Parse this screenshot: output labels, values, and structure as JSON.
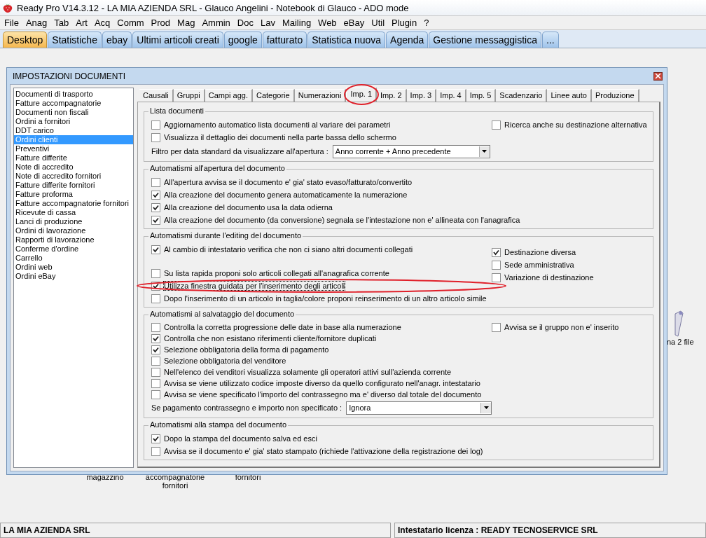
{
  "window": {
    "title": "Ready Pro V14.3.12 - LA MIA AZIENDA SRL - Glauco Angelini - Notebook di Glauco - ADO mode"
  },
  "menu": [
    "File",
    "Anag",
    "Tab",
    "Art",
    "Acq",
    "Comm",
    "Prod",
    "Mag",
    "Ammin",
    "Doc",
    "Lav",
    "Mailing",
    "Web",
    "eBay",
    "Util",
    "Plugin",
    "?"
  ],
  "tabs": [
    {
      "label": "Desktop",
      "selected": true
    },
    {
      "label": "Statistiche",
      "selected": false
    },
    {
      "label": "ebay",
      "selected": false
    },
    {
      "label": "Ultimi articoli creati",
      "selected": false
    },
    {
      "label": "google",
      "selected": false
    },
    {
      "label": "fatturato",
      "selected": false
    },
    {
      "label": "Statistica nuova",
      "selected": false
    },
    {
      "label": "Agenda",
      "selected": false
    },
    {
      "label": "Gestione messaggistica",
      "selected": false
    },
    {
      "label": "...",
      "selected": false
    }
  ],
  "desktop_icons": [
    {
      "label": "magazzino"
    },
    {
      "label": "accompagnatorie fornitori"
    },
    {
      "label": "fornitori"
    },
    {
      "label": "na 2 file"
    }
  ],
  "dialog": {
    "title": "IMPOSTAZIONI DOCUMENTI",
    "document_types": [
      {
        "label": "Documenti di trasporto",
        "selected": false
      },
      {
        "label": "Fatture accompagnatorie",
        "selected": false
      },
      {
        "label": "Documenti non fiscali",
        "selected": false
      },
      {
        "label": "Ordini a fornitori",
        "selected": false
      },
      {
        "label": "DDT carico",
        "selected": false
      },
      {
        "label": "Ordini clienti",
        "selected": true
      },
      {
        "label": "Preventivi",
        "selected": false
      },
      {
        "label": "Fatture differite",
        "selected": false
      },
      {
        "label": "Note di accredito",
        "selected": false
      },
      {
        "label": "Note di accredito fornitori",
        "selected": false
      },
      {
        "label": "Fatture differite fornitori",
        "selected": false
      },
      {
        "label": "Fatture proforma",
        "selected": false
      },
      {
        "label": "Fatture accompagnatorie fornitori",
        "selected": false
      },
      {
        "label": "Ricevute di cassa",
        "selected": false
      },
      {
        "label": "Lanci di produzione",
        "selected": false
      },
      {
        "label": "Ordini di lavorazione",
        "selected": false
      },
      {
        "label": "Rapporti di lavorazione",
        "selected": false
      },
      {
        "label": "Conferme d'ordine",
        "selected": false
      },
      {
        "label": "Carrello",
        "selected": false
      },
      {
        "label": "Ordini web",
        "selected": false
      },
      {
        "label": "Ordini eBay",
        "selected": false
      }
    ],
    "tabs": [
      {
        "label": "Causali",
        "selected": false
      },
      {
        "label": "Gruppi",
        "selected": false
      },
      {
        "label": "Campi agg.",
        "selected": false
      },
      {
        "label": "Categorie",
        "selected": false
      },
      {
        "label": "Numerazioni",
        "selected": false
      },
      {
        "label": "Imp. 1",
        "selected": true
      },
      {
        "label": "Imp. 2",
        "selected": false
      },
      {
        "label": "Imp. 3",
        "selected": false
      },
      {
        "label": "Imp. 4",
        "selected": false
      },
      {
        "label": "Imp. 5",
        "selected": false
      },
      {
        "label": "Scadenzario",
        "selected": false
      },
      {
        "label": "Linee auto",
        "selected": false
      },
      {
        "label": "Produzione",
        "selected": false
      }
    ],
    "groups": [
      {
        "title": "Lista documenti",
        "rows": [
          {
            "kind": "checkbox",
            "label": "Aggiornamento automatico lista documenti al variare dei parametri",
            "checked": false
          },
          {
            "kind": "checkbox",
            "label": "Visualizza il dettaglio dei documenti nella parte bassa dello schermo",
            "checked": false
          },
          {
            "kind": "combo",
            "label": "Filtro per data standard da visualizzare all'apertura :",
            "value": "Anno corrente + Anno precedente"
          }
        ],
        "side": [
          {
            "label": "Ricerca anche su destinazione alternativa",
            "checked": false
          }
        ]
      },
      {
        "title": "Automatismi all'apertura del documento",
        "rows": [
          {
            "kind": "checkbox",
            "label": "All'apertura avvisa se il documento e' gia' stato evaso/fatturato/convertito",
            "checked": false
          },
          {
            "kind": "checkbox",
            "label": "Alla creazione del documento genera automaticamente la numerazione",
            "checked": true
          },
          {
            "kind": "checkbox",
            "label": "Alla creazione del documento usa la data odierna",
            "checked": true
          },
          {
            "kind": "checkbox",
            "label": "Alla creazione del documento (da conversione) segnala se l'intestazione non e' allineata con l'anagrafica",
            "checked": true
          }
        ]
      },
      {
        "title": "Automatismi durante l'editing del documento",
        "rows": [
          {
            "kind": "checkbox",
            "label": "Al cambio di intestatario verifica che non ci siano altri documenti collegati",
            "checked": true
          },
          {
            "kind": "checkbox",
            "label": "Su lista rapida proponi solo articoli collegati all'anagrafica corrente",
            "checked": false,
            "gap_before": true
          },
          {
            "kind": "checkbox",
            "label": "Utilizza finestra guidata per l'inserimento degli articoli",
            "checked": true,
            "focused": true
          },
          {
            "kind": "checkbox",
            "label": "Dopo l'inserimento di un articolo in taglia/colore proponi reinserimento di un altro articolo simile",
            "checked": false
          }
        ],
        "side": [
          {
            "label": "Destinazione diversa",
            "checked": true
          },
          {
            "label": "Sede amministrativa",
            "checked": false
          },
          {
            "label": "Variazione di destinazione",
            "checked": false
          }
        ]
      },
      {
        "title": "Automatismi al salvataggio del documento",
        "rows": [
          {
            "kind": "checkbox",
            "label": "Controlla la corretta progressione delle date in base alla numerazione",
            "checked": false
          },
          {
            "kind": "checkbox",
            "label": "Controlla che non esistano riferimenti cliente/fornitore duplicati",
            "checked": true
          },
          {
            "kind": "checkbox",
            "label": "Selezione obbligatoria della forma di pagamento",
            "checked": true
          },
          {
            "kind": "checkbox",
            "label": "Selezione obbligatoria del venditore",
            "checked": false
          },
          {
            "kind": "checkbox",
            "label": "Nell'elenco dei venditori visualizza solamente gli operatori attivi sull'azienda corrente",
            "checked": false
          },
          {
            "kind": "checkbox",
            "label": "Avvisa se viene utilizzato codice imposte diverso da quello configurato nell'anagr. intestatario",
            "checked": false
          },
          {
            "kind": "checkbox",
            "label": "Avvisa se viene specificato l'importo del contrassegno ma e' diverso dal totale del documento",
            "checked": false
          },
          {
            "kind": "combo",
            "label": "Se pagamento contrassegno e importo non specificato :",
            "value": "Ignora"
          }
        ],
        "side": [
          {
            "label": "Avvisa se il gruppo non e' inserito",
            "checked": false
          }
        ]
      },
      {
        "title": "Automatismi alla stampa del documento",
        "rows": [
          {
            "kind": "checkbox",
            "label": "Dopo la stampa del documento salva ed esci",
            "checked": true
          },
          {
            "kind": "checkbox",
            "label": "Avvisa se il documento e' gia' stato stampato (richiede l'attivazione della registrazione dei log)",
            "checked": false
          }
        ]
      }
    ]
  },
  "status_bar": {
    "company": "LA MIA AZIENDA SRL",
    "license": "Intestatario licenza : READY TECNOSERVICE SRL"
  }
}
